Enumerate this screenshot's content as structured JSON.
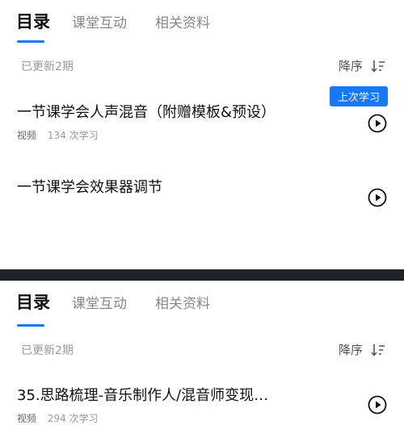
{
  "tabs": [
    "目录",
    "课堂互动",
    "相关资料"
  ],
  "top_panel": {
    "updated": "已更新2期",
    "sort_label": "降序",
    "last_study_badge": "上次学习",
    "items": [
      {
        "title": "一节课学会人声混音（附赠模板&预设）",
        "kind": "视频",
        "views": "134 次学习"
      },
      {
        "title": "一节课学会效果器调节"
      }
    ]
  },
  "bottom_panel": {
    "updated": "已更新2期",
    "sort_label": "降序",
    "items": [
      {
        "title": "35.思路梳理-音乐制作人/混音师变现…",
        "kind": "视频",
        "views": "294 次学习"
      }
    ]
  },
  "colors": {
    "accent": "#1677ff",
    "divider": "#1f2327",
    "text_primary": "#111111",
    "text_muted": "#999999"
  },
  "icons": [
    "sort-descending-icon",
    "play-circle-icon"
  ]
}
